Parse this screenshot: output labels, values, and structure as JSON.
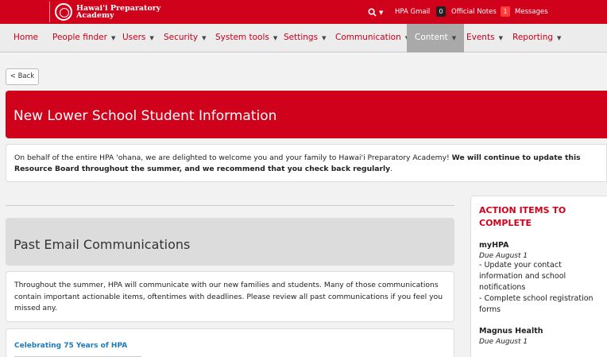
{
  "topbar": {
    "logo_line1": "Hawai'i Preparatory",
    "logo_line2": "Academy",
    "search_icon": "search-icon",
    "gmail_label": "HPA Gmail",
    "notes_count": "0",
    "notes_label": "Official Notes",
    "messages_count": "1",
    "messages_label": "Messages",
    "brand_color": "#d0021b"
  },
  "nav": {
    "items": [
      {
        "label": "Home",
        "dropdown": false
      },
      {
        "label": "People finder",
        "dropdown": true
      },
      {
        "label": "Users",
        "dropdown": true
      },
      {
        "label": "Security",
        "dropdown": true
      },
      {
        "label": "System tools",
        "dropdown": true
      },
      {
        "label": "Settings",
        "dropdown": true
      },
      {
        "label": "Communication",
        "dropdown": true
      },
      {
        "label": "Content",
        "dropdown": true,
        "active": true
      },
      {
        "label": "Events",
        "dropdown": true
      },
      {
        "label": "Reporting",
        "dropdown": true
      }
    ]
  },
  "back_button": "< Back",
  "banner_title": "New Lower School Student Information",
  "intro": {
    "text": "On behalf of the entire HPA 'ohana, we are delighted to welcome you and your family to Hawai'i Preparatory Academy! ",
    "bold_text": "We will continue to update this Resource Board throughout the summer, and we recommend that you check back regularly",
    "end": "."
  },
  "section": {
    "title": "Past Email Communications",
    "body": "Throughout the summer, HPA will communicate with our new families and students. Many of those communications contain important actionable items, oftentimes with deadlines. Please review all past communications if you feel you missed any.",
    "card_link": "Celebrating 75 Years of HPA"
  },
  "sidebar": {
    "title": "ACTION ITEMS TO COMPLETE",
    "items": [
      {
        "title": "myHPA",
        "due": "Due August 1",
        "lines": [
          "- Update your contact information and school notifications",
          "- Complete school registration forms"
        ]
      },
      {
        "title": "Magnus Health",
        "due": "Due August 1",
        "lines": []
      }
    ]
  }
}
